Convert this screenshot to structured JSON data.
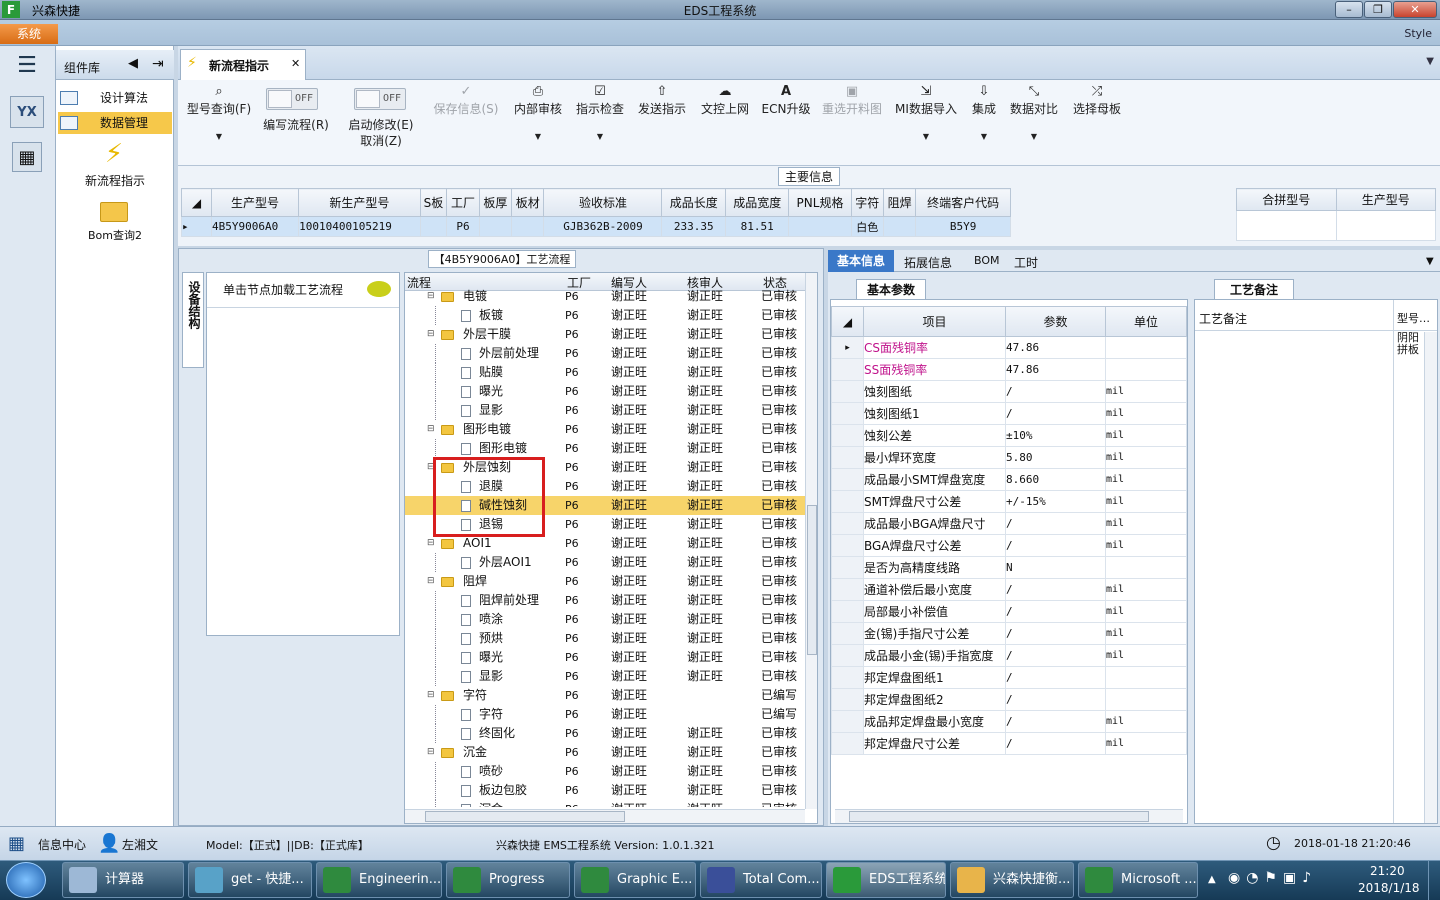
{
  "window": {
    "app_title": "兴森快捷",
    "title": "EDS工程系统"
  },
  "menu": {
    "system": "系统",
    "style": "Style"
  },
  "component_lib": {
    "title": "组件库",
    "items": [
      "设计算法",
      "数据管理"
    ],
    "tiles": [
      "新流程指示",
      "Bom查询2"
    ]
  },
  "doc_tab": {
    "label": "新流程指示"
  },
  "toolbar": {
    "buttons": [
      {
        "label": "型号查询(F)",
        "icon": "search-icon",
        "enabled": true
      },
      {
        "label": "编写流程(R)",
        "icon": "toggle-off",
        "enabled": true
      },
      {
        "label": "启动修改(E)",
        "label2": "取消(Z)",
        "icon": "toggle-off",
        "enabled": true
      },
      {
        "label": "保存信息(S)",
        "icon": "check-icon",
        "enabled": false
      },
      {
        "label": "内部审核",
        "icon": "print-icon",
        "enabled": true
      },
      {
        "label": "指示检查",
        "icon": "checkbox-icon",
        "enabled": true
      },
      {
        "label": "发送指示",
        "icon": "upload-icon",
        "enabled": true
      },
      {
        "label": "文控上网",
        "icon": "cloud-upload-icon",
        "enabled": true
      },
      {
        "label": "ECN升级",
        "icon": "ecn-icon",
        "enabled": true
      },
      {
        "label": "重选开料图",
        "icon": "image-icon",
        "enabled": false
      },
      {
        "label": "MI数据导入",
        "icon": "import-icon",
        "enabled": true
      },
      {
        "label": "集成",
        "icon": "download-icon",
        "enabled": true
      },
      {
        "label": "数据对比",
        "icon": "compare-icon",
        "enabled": true
      },
      {
        "label": "选择母板",
        "icon": "shuffle-icon",
        "enabled": true
      }
    ],
    "toggle_text": "OFF"
  },
  "main_info": {
    "title": "主要信息",
    "columns": [
      "生产型号",
      "新生产型号",
      "S板",
      "工厂",
      "板厚",
      "板材",
      "验收标准",
      "成品长度",
      "成品宽度",
      "PNL规格",
      "字符",
      "阻焊",
      "终端客户代码"
    ],
    "row": [
      "4B5Y9006A0",
      "10010400105219",
      "",
      "P6",
      "",
      "",
      "GJB362B-2009",
      "233.35",
      "81.51",
      "",
      "白色",
      "",
      "B5Y9"
    ],
    "right_columns": [
      "合拼型号",
      "生产型号"
    ]
  },
  "process": {
    "title": "【4B5Y9006A0】工艺流程",
    "side_tab": "设备结构",
    "hint": "单击节点加载工艺流程",
    "columns": [
      "流程",
      "工厂",
      "编写人",
      "核审人",
      "状态"
    ],
    "rows": [
      {
        "level": 0,
        "name": "电镀",
        "factory": "P6",
        "writer": "谢正旺",
        "reviewer": "谢正旺",
        "status": "已审核"
      },
      {
        "level": 1,
        "name": "板镀",
        "factory": "P6",
        "writer": "谢正旺",
        "reviewer": "谢正旺",
        "status": "已审核"
      },
      {
        "level": 0,
        "name": "外层干膜",
        "factory": "P6",
        "writer": "谢正旺",
        "reviewer": "谢正旺",
        "status": "已审核"
      },
      {
        "level": 1,
        "name": "外层前处理",
        "factory": "P6",
        "writer": "谢正旺",
        "reviewer": "谢正旺",
        "status": "已审核"
      },
      {
        "level": 1,
        "name": "贴膜",
        "factory": "P6",
        "writer": "谢正旺",
        "reviewer": "谢正旺",
        "status": "已审核"
      },
      {
        "level": 1,
        "name": "曝光",
        "factory": "P6",
        "writer": "谢正旺",
        "reviewer": "谢正旺",
        "status": "已审核"
      },
      {
        "level": 1,
        "name": "显影",
        "factory": "P6",
        "writer": "谢正旺",
        "reviewer": "谢正旺",
        "status": "已审核"
      },
      {
        "level": 0,
        "name": "图形电镀",
        "factory": "P6",
        "writer": "谢正旺",
        "reviewer": "谢正旺",
        "status": "已审核"
      },
      {
        "level": 1,
        "name": "图形电镀",
        "factory": "P6",
        "writer": "谢正旺",
        "reviewer": "谢正旺",
        "status": "已审核"
      },
      {
        "level": 0,
        "name": "外层蚀刻",
        "factory": "P6",
        "writer": "谢正旺",
        "reviewer": "谢正旺",
        "status": "已审核"
      },
      {
        "level": 1,
        "name": "退膜",
        "factory": "P6",
        "writer": "谢正旺",
        "reviewer": "谢正旺",
        "status": "已审核"
      },
      {
        "level": 1,
        "name": "碱性蚀刻",
        "factory": "P6",
        "writer": "谢正旺",
        "reviewer": "谢正旺",
        "status": "已审核",
        "selected": true
      },
      {
        "level": 1,
        "name": "退锡",
        "factory": "P6",
        "writer": "谢正旺",
        "reviewer": "谢正旺",
        "status": "已审核"
      },
      {
        "level": 0,
        "name": "AOI1",
        "factory": "P6",
        "writer": "谢正旺",
        "reviewer": "谢正旺",
        "status": "已审核"
      },
      {
        "level": 1,
        "name": "外层AOI1",
        "factory": "P6",
        "writer": "谢正旺",
        "reviewer": "谢正旺",
        "status": "已审核"
      },
      {
        "level": 0,
        "name": "阻焊",
        "factory": "P6",
        "writer": "谢正旺",
        "reviewer": "谢正旺",
        "status": "已审核"
      },
      {
        "level": 1,
        "name": "阻焊前处理",
        "factory": "P6",
        "writer": "谢正旺",
        "reviewer": "谢正旺",
        "status": "已审核"
      },
      {
        "level": 1,
        "name": "喷涂",
        "factory": "P6",
        "writer": "谢正旺",
        "reviewer": "谢正旺",
        "status": "已审核"
      },
      {
        "level": 1,
        "name": "预烘",
        "factory": "P6",
        "writer": "谢正旺",
        "reviewer": "谢正旺",
        "status": "已审核"
      },
      {
        "level": 1,
        "name": "曝光",
        "factory": "P6",
        "writer": "谢正旺",
        "reviewer": "谢正旺",
        "status": "已审核"
      },
      {
        "level": 1,
        "name": "显影",
        "factory": "P6",
        "writer": "谢正旺",
        "reviewer": "谢正旺",
        "status": "已审核"
      },
      {
        "level": 0,
        "name": "字符",
        "factory": "P6",
        "writer": "谢正旺",
        "reviewer": "",
        "status": "已编写"
      },
      {
        "level": 1,
        "name": "字符",
        "factory": "P6",
        "writer": "谢正旺",
        "reviewer": "",
        "status": "已编写"
      },
      {
        "level": 1,
        "name": "终固化",
        "factory": "P6",
        "writer": "谢正旺",
        "reviewer": "谢正旺",
        "status": "已审核"
      },
      {
        "level": 0,
        "name": "沉金",
        "factory": "P6",
        "writer": "谢正旺",
        "reviewer": "谢正旺",
        "status": "已审核"
      },
      {
        "level": 1,
        "name": "喷砂",
        "factory": "P6",
        "writer": "谢正旺",
        "reviewer": "谢正旺",
        "status": "已审核"
      },
      {
        "level": 1,
        "name": "板边包胶",
        "factory": "P6",
        "writer": "谢正旺",
        "reviewer": "谢正旺",
        "status": "已审核"
      },
      {
        "level": 1,
        "name": "沉金",
        "factory": "P6",
        "writer": "谢正旺",
        "reviewer": "谢正旺",
        "status": "已审核"
      }
    ]
  },
  "detail_tabs": [
    "基本信息",
    "拓展信息",
    "BOM",
    "工时"
  ],
  "params": {
    "tab": "基本参数",
    "columns": [
      "项目",
      "参数",
      "单位"
    ],
    "rows": [
      {
        "item": "CS面残铜率",
        "value": "47.86",
        "unit": "",
        "pink": true
      },
      {
        "item": "SS面残铜率",
        "value": "47.86",
        "unit": "",
        "pink": true
      },
      {
        "item": "蚀刻图纸",
        "value": "/",
        "unit": "mil"
      },
      {
        "item": "蚀刻图纸1",
        "value": "/",
        "unit": "mil"
      },
      {
        "item": "蚀刻公差",
        "value": "±10%",
        "unit": "mil"
      },
      {
        "item": "最小焊环宽度",
        "value": "5.80",
        "unit": "mil"
      },
      {
        "item": "成品最小SMT焊盘宽度",
        "value": "8.660",
        "unit": "mil"
      },
      {
        "item": "SMT焊盘尺寸公差",
        "value": "+/-15%",
        "unit": "mil"
      },
      {
        "item": "成品最小BGA焊盘尺寸",
        "value": "/",
        "unit": "mil"
      },
      {
        "item": "BGA焊盘尺寸公差",
        "value": "/",
        "unit": "mil"
      },
      {
        "item": "是否为高精度线路",
        "value": "N",
        "unit": ""
      },
      {
        "item": "通道补偿后最小宽度",
        "value": "/",
        "unit": "mil"
      },
      {
        "item": "局部最小补偿值",
        "value": "/",
        "unit": "mil"
      },
      {
        "item": "金(锡)手指尺寸公差",
        "value": "/",
        "unit": "mil"
      },
      {
        "item": "成品最小金(锡)手指宽度",
        "value": "/",
        "unit": "mil"
      },
      {
        "item": "邦定焊盘图纸1",
        "value": "/",
        "unit": ""
      },
      {
        "item": "邦定焊盘图纸2",
        "value": "/",
        "unit": ""
      },
      {
        "item": "成品邦定焊盘最小宽度",
        "value": "/",
        "unit": "mil"
      },
      {
        "item": "邦定焊盘尺寸公差",
        "value": "/",
        "unit": "mil"
      }
    ]
  },
  "notes": {
    "tab": "工艺备注",
    "col1": "工艺备注",
    "col2": "型号…",
    "value": "阴阳拼板"
  },
  "status": {
    "info_center": "信息中心",
    "user": "左湘文",
    "model": "Model:【正式】||DB:【正式库】",
    "version": "兴森快捷 EMS工程系统 Version: 1.0.1.321",
    "datetime": "2018-01-18 21:20:46"
  },
  "taskbar": {
    "tasks": [
      "计算器",
      "get - 快捷...",
      "Engineerin...",
      "Progress",
      "Graphic E...",
      "Total Com...",
      "EDS工程系统",
      "兴森快捷衡...",
      "Microsoft ..."
    ],
    "time": "21:20",
    "date": "2018/1/18"
  },
  "colors": {
    "accent_orange": "#e07a22",
    "selection": "#f7d46a",
    "highlight_box": "#d81e1e",
    "pink_text": "#c0148c"
  }
}
